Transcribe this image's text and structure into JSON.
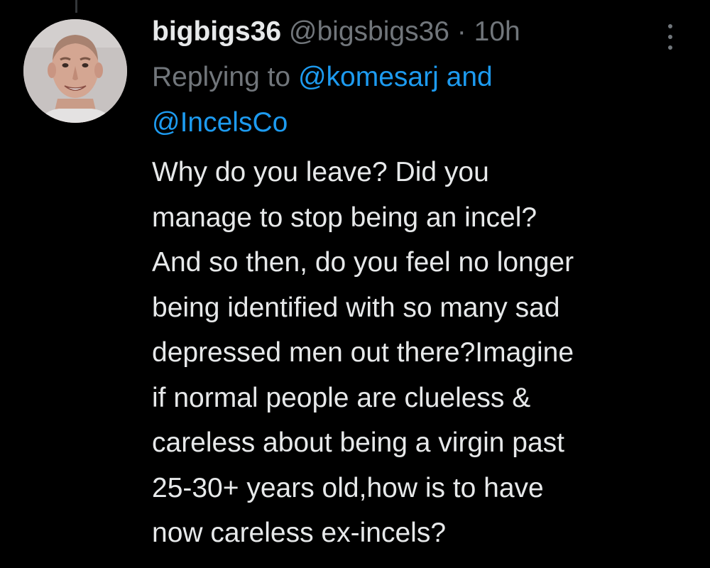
{
  "tweet": {
    "display_name": "bigbigs36",
    "handle": "@bigsbigs36",
    "separator": "·",
    "time": "10h",
    "more_icon": "more-vertical-icon",
    "reply_prefix": "Replying to",
    "reply_mention_1": "@komesarj",
    "reply_and": "and",
    "reply_mention_2": "@IncelsCo",
    "text_lines": [
      "Why do you leave? Did you",
      "manage to stop being an incel?",
      "And so then, do you feel no longer",
      "being identified with so many sad",
      "depressed men out there?Imagine",
      "if normal people are clueless &",
      "careless about being a virgin past",
      "25-30+ years old,how is to have",
      "now careless ex-incels?"
    ]
  },
  "colors": {
    "background": "#000000",
    "primary_text": "#e7e9ea",
    "secondary_text": "#71767b",
    "link": "#1d9bf0"
  }
}
